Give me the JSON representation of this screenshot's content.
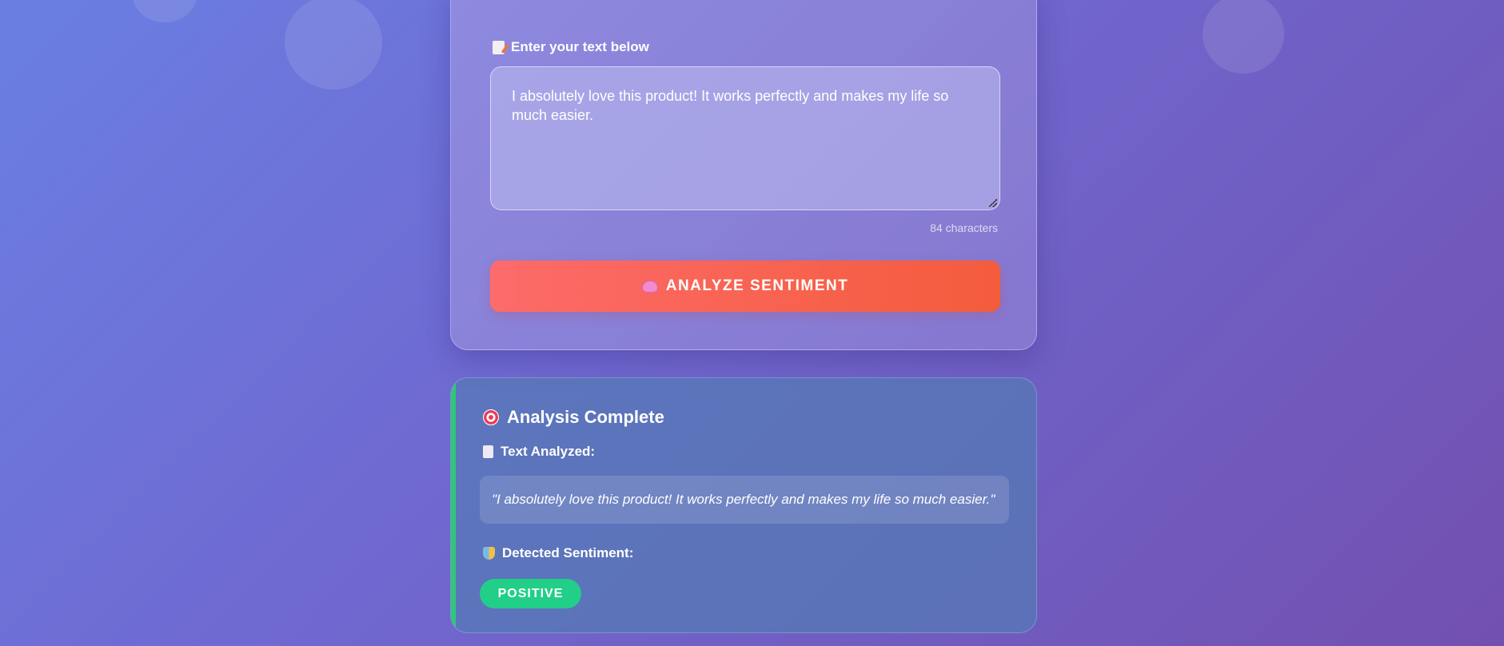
{
  "input_section": {
    "label": "Enter your text below",
    "label_icon": "memo-icon",
    "textarea_value": "I absolutely love this product! It works perfectly and makes my life so much easier.",
    "char_count": "84 characters",
    "analyze_button_label": "ANALYZE SENTIMENT",
    "analyze_button_icon": "brain-icon"
  },
  "result": {
    "title": "Analysis Complete",
    "title_icon": "target-icon",
    "text_analyzed_label": "Text Analyzed:",
    "text_analyzed_icon": "document-icon",
    "quoted_text": "\"I absolutely love this product! It works perfectly and makes my life so much easier.\"",
    "detected_label": "Detected Sentiment:",
    "detected_icon": "masks-icon",
    "sentiment": "POSITIVE"
  },
  "colors": {
    "background_start": "#6a7fe2",
    "background_end": "#7250b0",
    "button_start": "#fd6b6b",
    "button_end": "#f45c3c",
    "positive_accent": "#2ec87a",
    "badge": "#22cf88"
  }
}
